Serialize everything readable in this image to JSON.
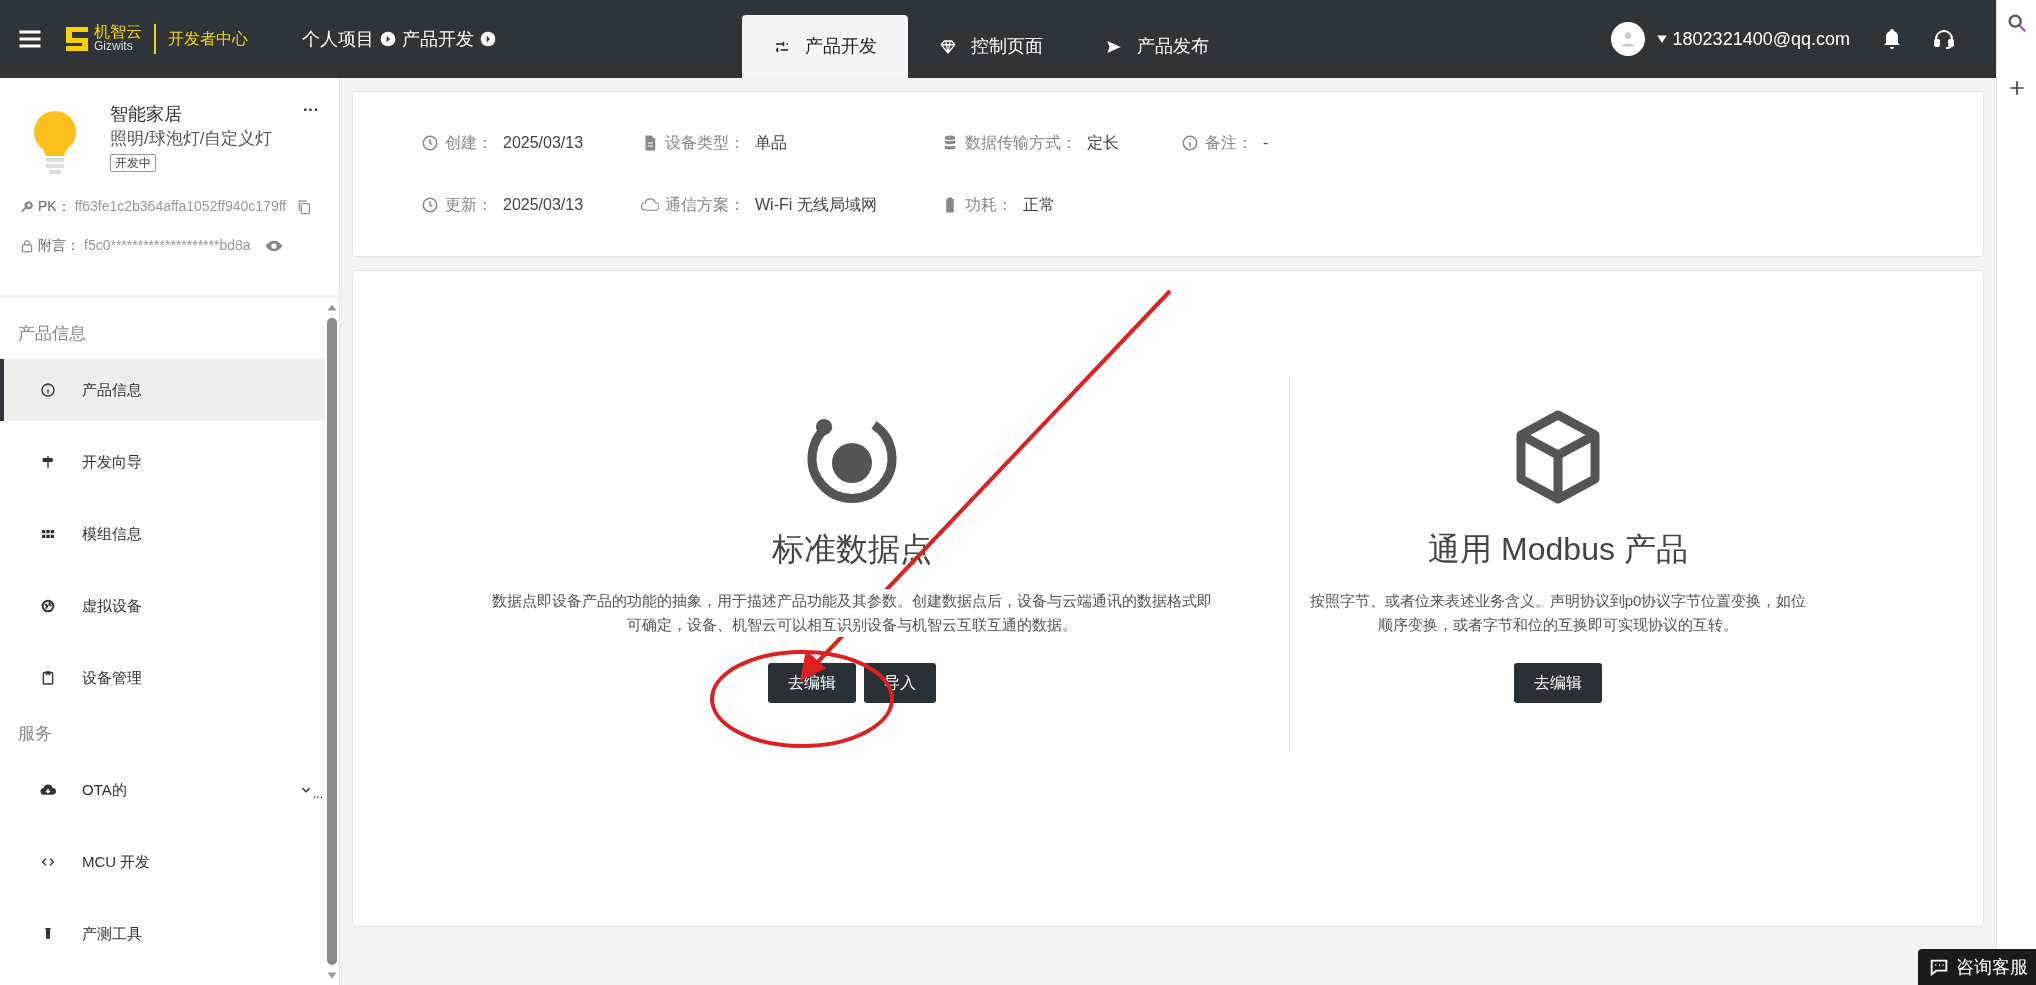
{
  "topbar": {
    "logo_cn": "机智云",
    "logo_en": "Gizwits",
    "portal": "开发者中心",
    "breadcrumb": [
      "个人项目",
      "产品开发"
    ],
    "tabs": [
      {
        "label": "产品开发",
        "selected": true
      },
      {
        "label": "控制页面",
        "selected": false
      },
      {
        "label": "产品发布",
        "selected": false
      }
    ],
    "user": "1802321400@qq.com"
  },
  "product": {
    "name": "智能家居",
    "category": "照明/球泡灯/自定义灯",
    "status": "开发中",
    "more": "···",
    "pk_label": "PK：",
    "pk": "ff63fe1c2b364affa1052ff940c179ff",
    "secret_label": "附言：",
    "secret": "f5c0********************bd8a"
  },
  "sidebar": [
    {
      "title": "产品信息",
      "items": [
        {
          "label": "产品信息",
          "selected": true
        },
        {
          "label": "开发向导",
          "selected": false
        },
        {
          "label": "模组信息",
          "selected": false
        },
        {
          "label": "虚拟设备",
          "selected": false
        },
        {
          "label": "设备管理",
          "selected": false
        }
      ]
    },
    {
      "title": "服务",
      "items": [
        {
          "label": "OTA的",
          "selected": false,
          "kind": "group",
          "more": "..."
        },
        {
          "label": "MCU 开发",
          "selected": false
        },
        {
          "label": "产测工具",
          "selected": false
        }
      ]
    }
  ],
  "info": [
    [
      {
        "label": "创建：",
        "value": "2025/03/13"
      },
      {
        "label": "设备类型：",
        "value": "单品"
      },
      {
        "label": "数据传输方式：",
        "value": "定长"
      },
      {
        "label": "备注：",
        "value": "-"
      }
    ],
    [
      {
        "label": "更新：",
        "value": "2025/03/13"
      },
      {
        "label": "通信方案：",
        "value": "Wi-Fi 无线局域网"
      },
      {
        "label": "功耗：",
        "value": "正常"
      }
    ]
  ],
  "options": [
    {
      "title": "标准数据点",
      "description": "数据点即设备产品的功能的抽象，用于描述产品功能及其参数。创建数据点后，设备与云端通讯的数据格式即可确定，设备、机智云可以相互识别设备与机智云互联互通的数据。",
      "buttons": [
        "去编辑",
        "导入"
      ]
    },
    {
      "title": "通用 Modbus 产品",
      "description": "按照字节、或者位来表述业务含义。声明协议到p0协议字节位置变换，如位顺序变换，或者字节和位的互换即可实现协议的互转。",
      "buttons": [
        "去编辑"
      ]
    }
  ],
  "chat": {
    "label": "咨询客服"
  }
}
